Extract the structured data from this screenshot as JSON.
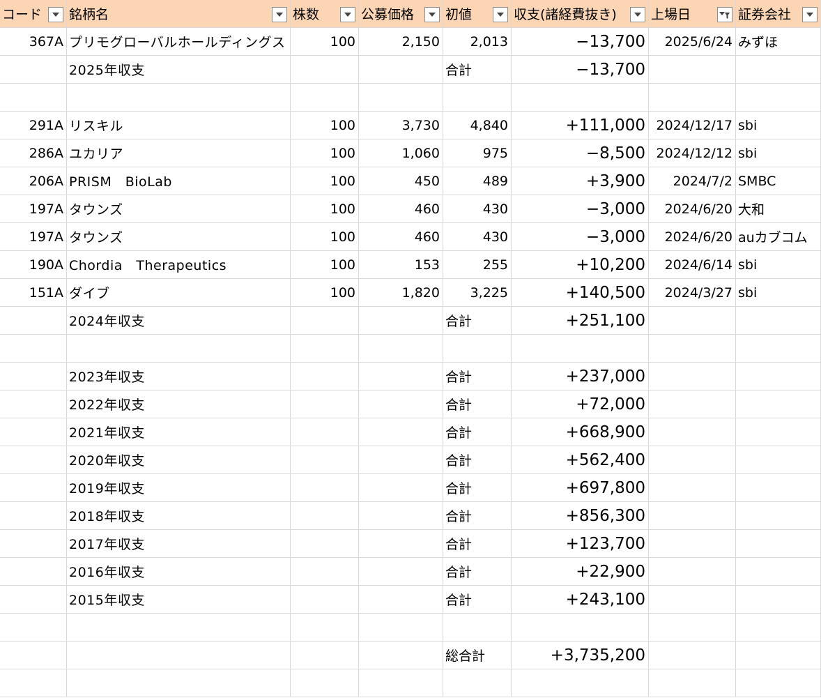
{
  "headers": [
    {
      "label": "コード",
      "filter_icon": "dropdown-arrow-icon"
    },
    {
      "label": "銘柄名",
      "filter_icon": "dropdown-arrow-icon"
    },
    {
      "label": "株数",
      "filter_icon": "dropdown-arrow-icon"
    },
    {
      "label": "公募価格",
      "filter_icon": "dropdown-arrow-icon"
    },
    {
      "label": "初値",
      "filter_icon": "dropdown-arrow-icon"
    },
    {
      "label": "収支(諸経費抜き)",
      "filter_icon": "dropdown-arrow-icon"
    },
    {
      "label": "上場日",
      "filter_icon": "filter-active-icon"
    },
    {
      "label": "証券会社",
      "filter_icon": "dropdown-arrow-icon"
    }
  ],
  "rows": [
    {
      "code": "367A",
      "name": "プリモグローバルホールディングス",
      "shares": "100",
      "offer_price": "2,150",
      "first_price": "2,013",
      "pnl": "−13,700",
      "listing_date": "2025/6/24",
      "broker": "みずほ"
    },
    {
      "code": "",
      "name": "2025年収支",
      "shares": "",
      "offer_price": "",
      "first_price": "合計",
      "pnl": "−13,700",
      "listing_date": "",
      "broker": ""
    },
    {
      "code": "",
      "name": "",
      "shares": "",
      "offer_price": "",
      "first_price": "",
      "pnl": "",
      "listing_date": "",
      "broker": ""
    },
    {
      "code": "291A",
      "name": "リスキル",
      "shares": "100",
      "offer_price": "3,730",
      "first_price": "4,840",
      "pnl": "+111,000",
      "listing_date": "2024/12/17",
      "broker": "sbi"
    },
    {
      "code": "286A",
      "name": "ユカリア",
      "shares": "100",
      "offer_price": "1,060",
      "first_price": "975",
      "pnl": "−8,500",
      "listing_date": "2024/12/12",
      "broker": "sbi"
    },
    {
      "code": "206A",
      "name": "PRISM　BioLab",
      "shares": "100",
      "offer_price": "450",
      "first_price": "489",
      "pnl": "+3,900",
      "listing_date": "2024/7/2",
      "broker": "SMBC"
    },
    {
      "code": "197A",
      "name": "タウンズ",
      "shares": "100",
      "offer_price": "460",
      "first_price": "430",
      "pnl": "−3,000",
      "listing_date": "2024/6/20",
      "broker": "大和"
    },
    {
      "code": "197A",
      "name": "タウンズ",
      "shares": "100",
      "offer_price": "460",
      "first_price": "430",
      "pnl": "−3,000",
      "listing_date": "2024/6/20",
      "broker": "auカブコム"
    },
    {
      "code": "190A",
      "name": "Chordia　Therapeutics",
      "shares": "100",
      "offer_price": "153",
      "first_price": "255",
      "pnl": "+10,200",
      "listing_date": "2024/6/14",
      "broker": "sbi"
    },
    {
      "code": "151A",
      "name": "ダイブ",
      "shares": "100",
      "offer_price": "1,820",
      "first_price": "3,225",
      "pnl": "+140,500",
      "listing_date": "2024/3/27",
      "broker": "sbi"
    },
    {
      "code": "",
      "name": "2024年収支",
      "shares": "",
      "offer_price": "",
      "first_price": "合計",
      "pnl": "+251,100",
      "listing_date": "",
      "broker": ""
    },
    {
      "code": "",
      "name": "",
      "shares": "",
      "offer_price": "",
      "first_price": "",
      "pnl": "",
      "listing_date": "",
      "broker": ""
    },
    {
      "code": "",
      "name": "2023年収支",
      "shares": "",
      "offer_price": "",
      "first_price": "合計",
      "pnl": "+237,000",
      "listing_date": "",
      "broker": ""
    },
    {
      "code": "",
      "name": "2022年収支",
      "shares": "",
      "offer_price": "",
      "first_price": "合計",
      "pnl": "+72,000",
      "listing_date": "",
      "broker": ""
    },
    {
      "code": "",
      "name": "2021年収支",
      "shares": "",
      "offer_price": "",
      "first_price": "合計",
      "pnl": "+668,900",
      "listing_date": "",
      "broker": ""
    },
    {
      "code": "",
      "name": "2020年収支",
      "shares": "",
      "offer_price": "",
      "first_price": "合計",
      "pnl": "+562,400",
      "listing_date": "",
      "broker": ""
    },
    {
      "code": "",
      "name": "2019年収支",
      "shares": "",
      "offer_price": "",
      "first_price": "合計",
      "pnl": "+697,800",
      "listing_date": "",
      "broker": ""
    },
    {
      "code": "",
      "name": "2018年収支",
      "shares": "",
      "offer_price": "",
      "first_price": "合計",
      "pnl": "+856,300",
      "listing_date": "",
      "broker": ""
    },
    {
      "code": "",
      "name": "2017年収支",
      "shares": "",
      "offer_price": "",
      "first_price": "合計",
      "pnl": "+123,700",
      "listing_date": "",
      "broker": ""
    },
    {
      "code": "",
      "name": "2016年収支",
      "shares": "",
      "offer_price": "",
      "first_price": "合計",
      "pnl": "+22,900",
      "listing_date": "",
      "broker": ""
    },
    {
      "code": "",
      "name": "2015年収支",
      "shares": "",
      "offer_price": "",
      "first_price": "合計",
      "pnl": "+243,100",
      "listing_date": "",
      "broker": ""
    },
    {
      "code": "",
      "name": "",
      "shares": "",
      "offer_price": "",
      "first_price": "",
      "pnl": "",
      "listing_date": "",
      "broker": ""
    },
    {
      "code": "",
      "name": "",
      "shares": "",
      "offer_price": "",
      "first_price": "総合計",
      "pnl": "+3,735,200",
      "listing_date": "",
      "broker": ""
    },
    {
      "code": "",
      "name": "",
      "shares": "",
      "offer_price": "",
      "first_price": "",
      "pnl": "",
      "listing_date": "",
      "broker": ""
    }
  ],
  "colors": {
    "header_bg": "#fcd5b4",
    "grid": "#d9d9d9"
  }
}
